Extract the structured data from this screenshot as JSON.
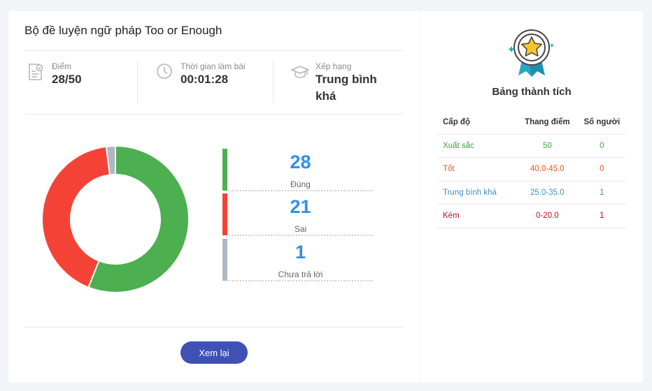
{
  "quiz": {
    "title": "Bộ đề luyện ngữ pháp Too or Enough",
    "stats": [
      {
        "label": "Điểm",
        "value": "28/50",
        "icon": "score-sheet-icon"
      },
      {
        "label": "Thời gian làm bài",
        "value": "00:01:28",
        "icon": "clock-icon"
      },
      {
        "label": "Xếp hạng",
        "value": "Trung bình khá",
        "icon": "graduation-cap-icon"
      }
    ]
  },
  "results": {
    "correct": {
      "count": "28",
      "label": "Đúng",
      "color": "#4caf50"
    },
    "wrong": {
      "count": "21",
      "label": "Sai",
      "color": "#f44336"
    },
    "unanswered": {
      "count": "1",
      "label": "Chưa trả lời",
      "color": "#aeb8c2"
    }
  },
  "chart_data": {
    "type": "pie",
    "categories": [
      "Đúng",
      "Sai",
      "Chưa trả lời"
    ],
    "values": [
      28,
      21,
      1
    ],
    "colors": [
      "#4caf50",
      "#f44336",
      "#aeb8c2"
    ]
  },
  "actions": {
    "review_label": "Xem lại"
  },
  "achievements": {
    "title": "Bảng thành tích",
    "headers": [
      "Cấp độ",
      "Thang điểm",
      "Số người"
    ],
    "rows": [
      {
        "level": "Xuất sắc",
        "range": "50",
        "people": "0",
        "color": "#3aa53e"
      },
      {
        "level": "Tốt",
        "range": "40.0-45.0",
        "people": "0",
        "color": "#f0541e"
      },
      {
        "level": "Trung bình khá",
        "range": "25.0-35.0",
        "people": "1",
        "color": "#3a93c4"
      },
      {
        "level": "Kém",
        "range": "0-20.0",
        "people": "1",
        "color": "#c2111f"
      }
    ]
  }
}
